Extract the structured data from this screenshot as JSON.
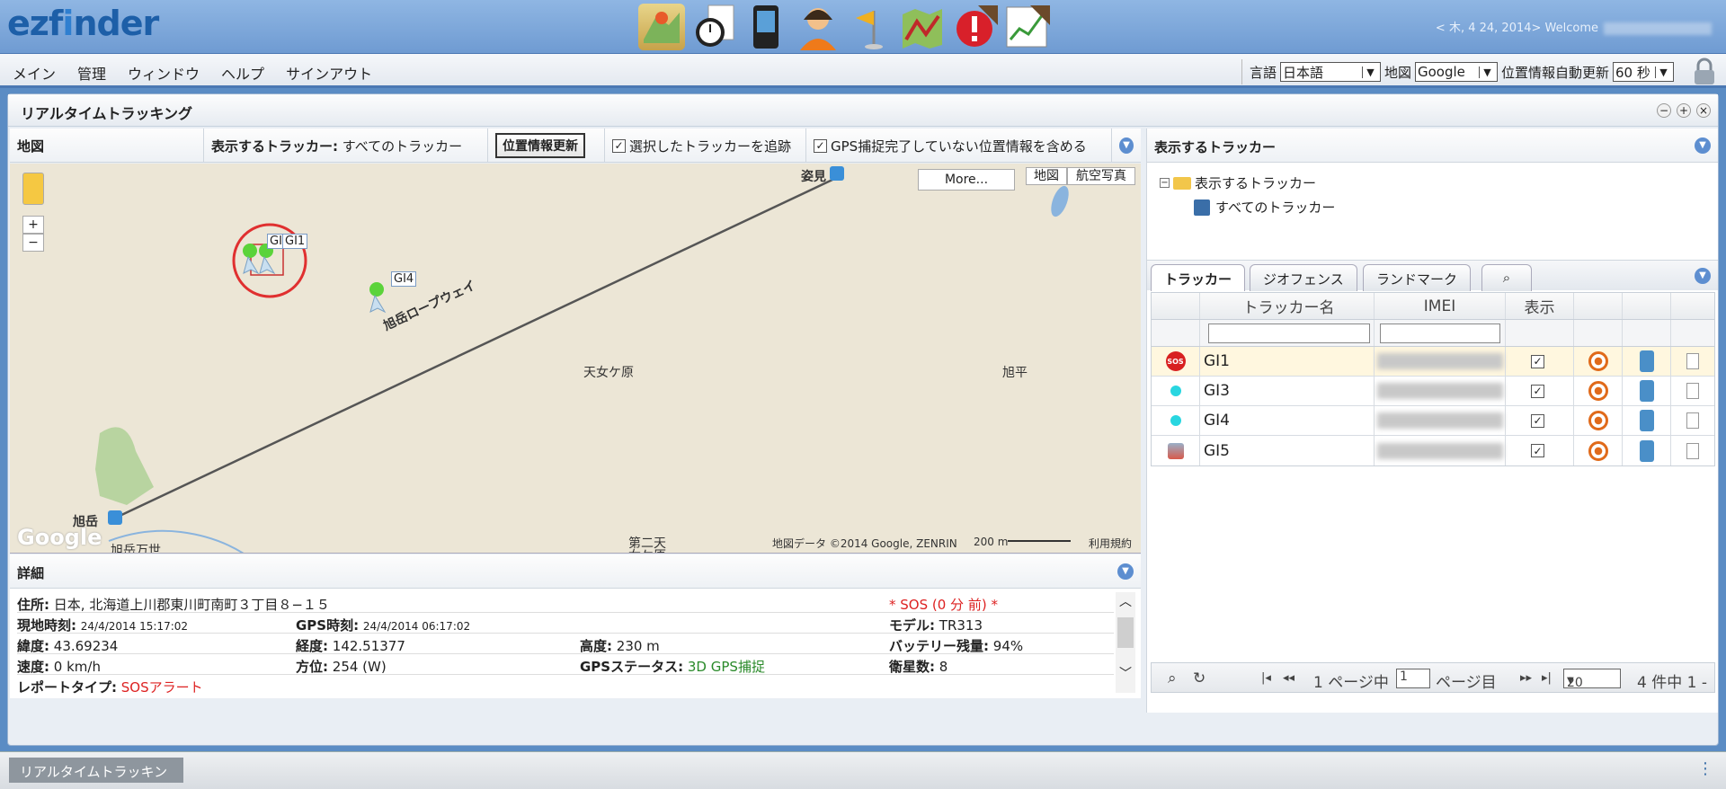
{
  "app": {
    "logo_prefix": "ezf",
    "logo_i": "i",
    "logo_suffix": "nder",
    "welcome": "< 木, 4 24, 2014> Welcome"
  },
  "toolbar_icons": [
    "map-pin-icon",
    "stopwatch-icon",
    "device-icon",
    "user-icon",
    "flag-icon",
    "route-map-icon",
    "alert-icon",
    "report-chart-icon"
  ],
  "menu": [
    "メイン",
    "管理",
    "ウィンドウ",
    "ヘルプ",
    "サインアウト"
  ],
  "prefs": {
    "language_label": "言語",
    "language_value": "日本語",
    "map_label": "地図",
    "map_value": "Google",
    "refresh_label": "位置情報自動更新",
    "refresh_value": "60 秒"
  },
  "window": {
    "title": "リアルタイムトラッキング"
  },
  "mapbar": {
    "map_label": "地図",
    "show_trackers_label": "表示するトラッカー:",
    "show_trackers_value": "すべてのトラッカー",
    "update_button": "位置情報更新",
    "follow_label": "選択したトラッカーを追跡",
    "include_gps_label": "GPS捕捉完了していない位置情報を含める"
  },
  "map": {
    "more_button": "More...",
    "type_map": "地図",
    "type_aerial": "航空写真",
    "places": {
      "sugami": "姿見",
      "ropeway": "旭岳ロープウェイ",
      "tennyogahara": "天女ケ原",
      "kyokuhei": "旭平",
      "asahidake": "旭岳",
      "daini": "第二天",
      "daini2": "女ケ原",
      "asahidake_bansei": "旭岳万世"
    },
    "markers": {
      "gi1": "GI1",
      "gi_short": "GI",
      "gi4": "GI4"
    },
    "google_logo": "Google",
    "attribution": "地図データ ©2014 Google, ZENRIN",
    "scale": "200 m",
    "terms": "利用規約"
  },
  "details": {
    "title": "詳細",
    "address_label": "住所:",
    "address_value": "日本, 北海道上川郡東川町南町３丁目８−１５",
    "sos_text": "* SOS (0 分 前) *",
    "local_time_label": "現地時刻:",
    "local_time_value": "24/4/2014 15:17:02",
    "gps_time_label": "GPS時刻:",
    "gps_time_value": "24/4/2014 06:17:02",
    "model_label": "モデル:",
    "model_value": "TR313",
    "lat_label": "緯度:",
    "lat_value": "43.69234",
    "lon_label": "経度:",
    "lon_value": "142.51377",
    "alt_label": "高度:",
    "alt_value": "230 m",
    "battery_label": "バッテリー残量:",
    "battery_value": "94%",
    "speed_label": "速度:",
    "speed_value": "0 km/h",
    "heading_label": "方位:",
    "heading_value": "254 (W)",
    "gps_status_label": "GPSステータス:",
    "gps_status_value": "3D GPS捕捉",
    "sat_label": "衛星数:",
    "sat_value": "8",
    "report_label": "レポートタイプ:",
    "report_value": "SOSアラート"
  },
  "right": {
    "title": "表示するトラッカー",
    "tree_root": "表示するトラッカー",
    "tree_child": "すべてのトラッカー",
    "tabs": [
      "トラッカー",
      "ジオフェンス",
      "ランドマーク"
    ],
    "columns": {
      "name": "トラッカー名",
      "imei": "IMEI",
      "show": "表示"
    },
    "rows": [
      {
        "name": "GI1",
        "status": "sos"
      },
      {
        "name": "GI3",
        "status": "online"
      },
      {
        "name": "GI4",
        "status": "online"
      },
      {
        "name": "GI5",
        "status": "other"
      }
    ],
    "pager": {
      "page_prefix": "1 ページ中",
      "page_value": "1",
      "page_suffix": "ページ目",
      "per_page": "20",
      "count": "4 件中 1 -"
    }
  },
  "taskbar": {
    "button": "リアルタイムトラッキン"
  }
}
